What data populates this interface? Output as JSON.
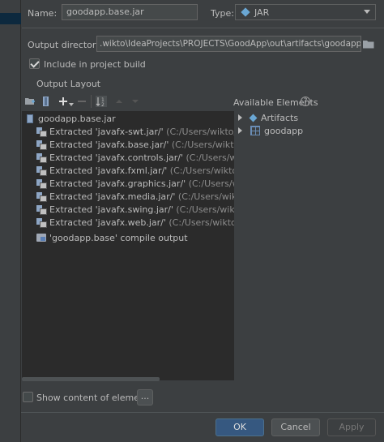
{
  "form": {
    "name_label": "Name:",
    "name_value": "goodapp.base.jar",
    "type_label": "Type:",
    "type_value": "JAR",
    "output_dir_label": "Output directory:",
    "output_dir_value": ".wikto\\IdeaProjects\\PROJECTS\\GoodApp\\out\\artifacts\\goodapp_base_jar",
    "include_label": "Include in project build",
    "include_checked": true
  },
  "layout": {
    "section_title": "Output Layout",
    "available_title": "Available Elements",
    "tree_root": "goodapp.base.jar",
    "tree_items": [
      {
        "name": "Extracted 'javafx-swt.jar/'",
        "path": "(C:/Users/wikto/Desktop/J"
      },
      {
        "name": "Extracted 'javafx.base.jar/'",
        "path": "(C:/Users/wikto/Desktop/"
      },
      {
        "name": "Extracted 'javafx.controls.jar/'",
        "path": "(C:/Users/wikto/Deskt"
      },
      {
        "name": "Extracted 'javafx.fxml.jar/'",
        "path": "(C:/Users/wikto/Desktop/"
      },
      {
        "name": "Extracted 'javafx.graphics.jar/'",
        "path": "(C:/Users/wikto/Deskto"
      },
      {
        "name": "Extracted 'javafx.media.jar/'",
        "path": "(C:/Users/wikto/Desktop"
      },
      {
        "name": "Extracted 'javafx.swing.jar/'",
        "path": "(C:/Users/wikto/Desktop"
      },
      {
        "name": "Extracted 'javafx.web.jar/'",
        "path": "(C:/Users/wikto/Desktop/"
      }
    ],
    "compile_output": "'goodapp.base' compile output",
    "available_items": [
      {
        "name": "Artifacts"
      },
      {
        "name": "goodapp"
      }
    ]
  },
  "footer": {
    "show_content_label": "Show content of elements",
    "ellipsis_label": "...",
    "ok_label": "OK",
    "cancel_label": "Cancel",
    "apply_label": "Apply"
  },
  "icons": {
    "help": "?"
  }
}
